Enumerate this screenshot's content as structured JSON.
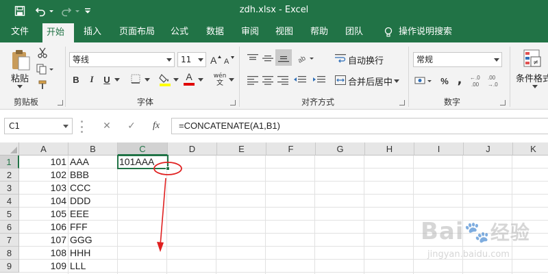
{
  "window": {
    "title": "zdh.xlsx  -  Excel"
  },
  "tabs": [
    "文件",
    "开始",
    "插入",
    "页面布局",
    "公式",
    "数据",
    "审阅",
    "视图",
    "帮助",
    "团队",
    "操作说明搜索"
  ],
  "ribbon": {
    "paste_label": "粘贴",
    "clipboard_label": "剪贴板",
    "font_name": "等线",
    "font_size": "11",
    "font_group_label": "字体",
    "bold": "B",
    "italic": "I",
    "underline": "U",
    "font_color_glyph": "A",
    "wen_glyph": "wén",
    "wrap_text": "自动换行",
    "merge_center": "合并后居中",
    "align_group_label": "对齐方式",
    "number_format": "常规",
    "percent": "%",
    "comma": ",",
    "number_group_label": "数字",
    "conditional_format": "条件格式",
    "brand_green": "#217346"
  },
  "formula_bar": {
    "name_box": "C1",
    "fx": "fx",
    "formula": "=CONCATENATE(A1,B1)"
  },
  "grid": {
    "columns": [
      "A",
      "B",
      "C",
      "D",
      "E",
      "F",
      "G",
      "H",
      "I",
      "J",
      "K"
    ],
    "rows": [
      "1",
      "2",
      "3",
      "4",
      "5",
      "6",
      "7",
      "8",
      "9"
    ],
    "col_a": [
      "101",
      "102",
      "103",
      "104",
      "105",
      "106",
      "107",
      "108",
      "109"
    ],
    "col_b": [
      "AAA",
      "BBB",
      "CCC",
      "DDD",
      "EEE",
      "FFF",
      "GGG",
      "HHH",
      "LLL"
    ],
    "c1": "101AAA",
    "selected_cell": "C1"
  },
  "annotation": {
    "color": "#e02020"
  },
  "watermark": {
    "brand": "Bai",
    "brand2": "经验",
    "url": "jingyan.baidu.com"
  }
}
